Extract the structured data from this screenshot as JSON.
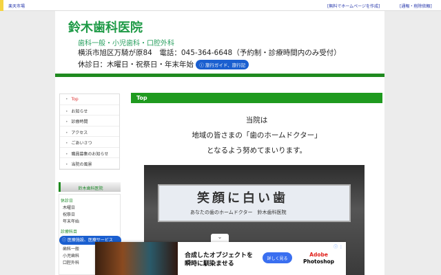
{
  "topbar": {
    "left": "楽天市場",
    "create": "[無料でホームページを作成]",
    "report": "[通報・削除依頼]"
  },
  "header": {
    "title": "鈴木歯科医院",
    "subtitle": "歯科一般・小児歯科・口腔外科",
    "address": "横浜市旭区万騎が原84　電話：045-364-6648（予約制・診療時間内のみ受付）",
    "holidays": "休診日：木曜日・祝祭日・年末年始",
    "badge": "ⓘ 旅行ガイド、旅行記"
  },
  "nav": [
    "Top",
    "お知らせ",
    "診療時間",
    "アクセス",
    "ごあいさつ",
    "職員募集のお知らせ",
    "当院の風景"
  ],
  "side": {
    "heading": "鈴木歯科医院",
    "holiday_label": "休診日",
    "holidays": [
      "木曜日",
      "祝祭日",
      "年末年始"
    ],
    "dept_label": "診療科目",
    "badge": "ⓘ 医療施設、医療サービス",
    "depts": [
      "歯科一般",
      "小児歯科",
      "口腔外科"
    ]
  },
  "main": {
    "section": "Top",
    "lines": [
      "当院は",
      "地域の皆さまの「歯のホームドクター」",
      "となるよう努めてまいります。"
    ],
    "sign_big": "笑顔に白い歯",
    "sign_small": "あなたの歯のホームドクター　鈴木歯科医院"
  },
  "ad": {
    "line1": "合成したオブジェクトを",
    "line2": "瞬時に馴染ませる",
    "button": "詳しく見る",
    "brand1": "Adobe",
    "brand2": "Photoshop",
    "info": "ⓘ ⋮",
    "collapse": "⌄"
  }
}
